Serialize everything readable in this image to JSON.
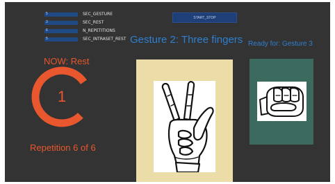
{
  "params": [
    {
      "value": "5",
      "label": "SEC_GESTURE"
    },
    {
      "value": "3",
      "label": "SEC_REST"
    },
    {
      "value": "6",
      "label": "N_REPETITIONS"
    },
    {
      "value": "5",
      "label": "SEC_INTRASET_REST"
    }
  ],
  "controls": {
    "start_stop_label": "START_STOP"
  },
  "current": {
    "title": "Gesture 2: Three fingers",
    "image_icon": "three-fingers-hand-icon"
  },
  "next": {
    "title": "Ready for: Gesture 3",
    "image_icon": "fist-hand-icon"
  },
  "status": {
    "now": "NOW: Rest",
    "countdown": "1",
    "countdown_fraction": 0.78,
    "repetition": "Repetition 6 of 6"
  },
  "colors": {
    "background": "#333333",
    "accent_orange": "#e8572d",
    "title_blue": "#2f7fd0",
    "input_blue": "#1f4a85",
    "current_panel": "#ecdca7",
    "next_panel": "#3b6a5e"
  }
}
